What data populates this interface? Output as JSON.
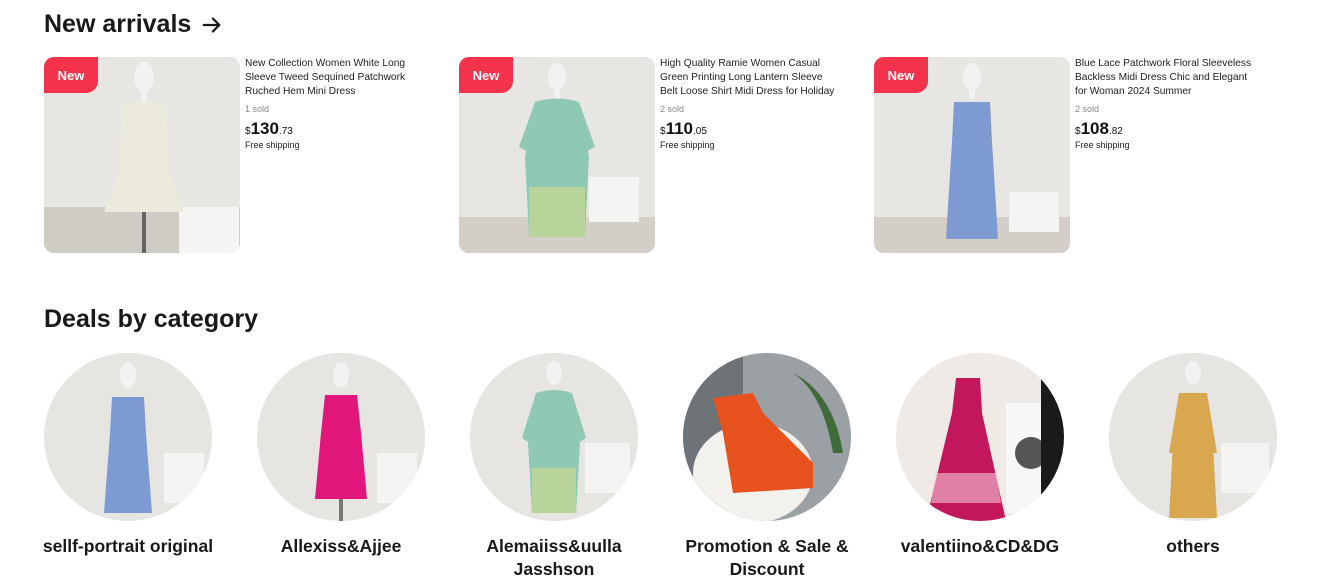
{
  "arrivals": {
    "title": "New arrivals",
    "products": [
      {
        "badge": "New",
        "title": "New Collection Women White Long Sleeve Tweed Sequined Patchwork Ruched Hem Mini Dress",
        "sold": "1 sold",
        "currency": "$",
        "price_int": "130",
        "price_dec": ".73",
        "shipping": "Free shipping",
        "dress_color": "#eceadc"
      },
      {
        "badge": "New",
        "title": "High Quality Ramie Women Casual Green Printing Long Lantern Sleeve Belt Loose Shirt Midi Dress for Holiday",
        "sold": "2 sold",
        "currency": "$",
        "price_int": "110",
        "price_dec": ".05",
        "shipping": "Free shipping",
        "dress_color": "#8fc9b4"
      },
      {
        "badge": "New",
        "title": "Blue Lace Patchwork Floral Sleeveless Backless Midi Dress Chic and Elegant for Woman 2024 Summer",
        "sold": "2 sold",
        "currency": "$",
        "price_int": "108",
        "price_dec": ".82",
        "shipping": "Free shipping",
        "dress_color": "#7d9ad3"
      }
    ]
  },
  "deals": {
    "title": "Deals by category",
    "categories": [
      {
        "label": "sellf-portrait original",
        "color": "#7d9ad3"
      },
      {
        "label": "Allexiss&Ajjee",
        "color": "#e0167a"
      },
      {
        "label": "Alemaiiss&uulla Jasshson",
        "color": "#8fc9b4"
      },
      {
        "label": "Promotion & Sale & Discount",
        "color": "#e8521f"
      },
      {
        "label": "valentiino&CD&DG",
        "color": "#c2185b"
      },
      {
        "label": "others",
        "color": "#d9a84e"
      }
    ]
  },
  "colors": {
    "badge": "#f2334b",
    "text": "#191919"
  }
}
